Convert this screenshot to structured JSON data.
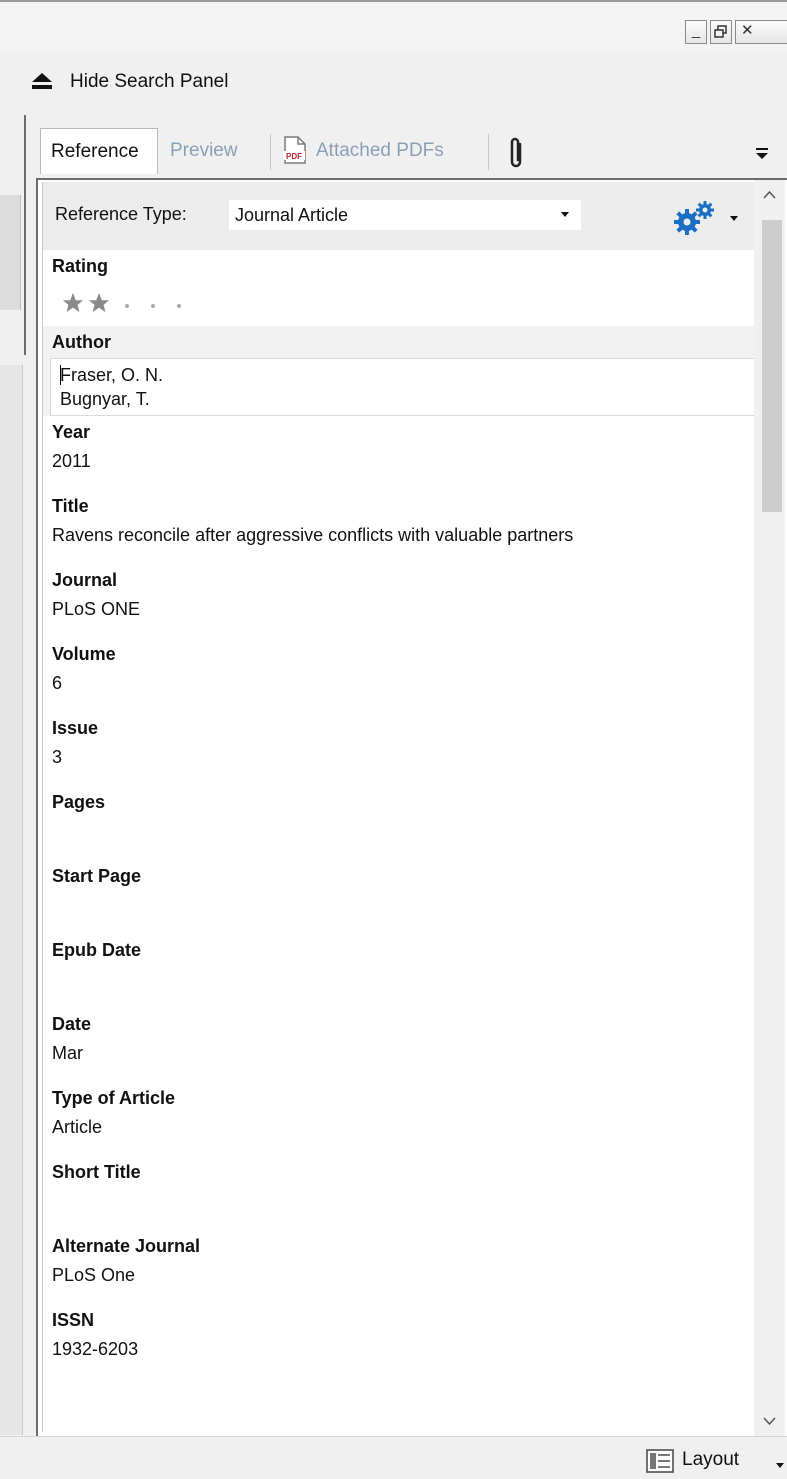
{
  "window": {
    "controls": [
      "_",
      "▯",
      "✕"
    ]
  },
  "search_panel": {
    "toggle_label": "Hide Search Panel"
  },
  "tabs": [
    {
      "label": "Reference",
      "active": true
    },
    {
      "label": "Preview",
      "active": false
    },
    {
      "label": "Attached PDFs",
      "active": false
    }
  ],
  "reference_type": {
    "label": "Reference Type:",
    "value": "Journal Article"
  },
  "rating": {
    "label": "Rating",
    "stars": 2,
    "max": 5
  },
  "author": {
    "label": "Author",
    "lines": [
      "Fraser, O. N.",
      "Bugnyar, T."
    ]
  },
  "fields": [
    {
      "label": "Year",
      "value": "2011"
    },
    {
      "label": "Title",
      "value": "Ravens reconcile after aggressive conflicts with valuable partners"
    },
    {
      "label": "Journal",
      "value": "PLoS ONE"
    },
    {
      "label": "Volume",
      "value": "6"
    },
    {
      "label": "Issue",
      "value": "3"
    },
    {
      "label": "Pages",
      "value": ""
    },
    {
      "label": "Start Page",
      "value": ""
    },
    {
      "label": "Epub Date",
      "value": ""
    },
    {
      "label": "Date",
      "value": "Mar"
    },
    {
      "label": "Type of Article",
      "value": "Article"
    },
    {
      "label": "Short Title",
      "value": ""
    },
    {
      "label": "Alternate Journal",
      "value": "PLoS One"
    },
    {
      "label": "ISSN",
      "value": "1932-6203"
    }
  ],
  "bottom": {
    "layout_label": "Layout"
  },
  "colors": {
    "accent_blue": "#1a6fc4",
    "star": "#8a8a8a",
    "tab_inactive": "#8aa0b8"
  }
}
